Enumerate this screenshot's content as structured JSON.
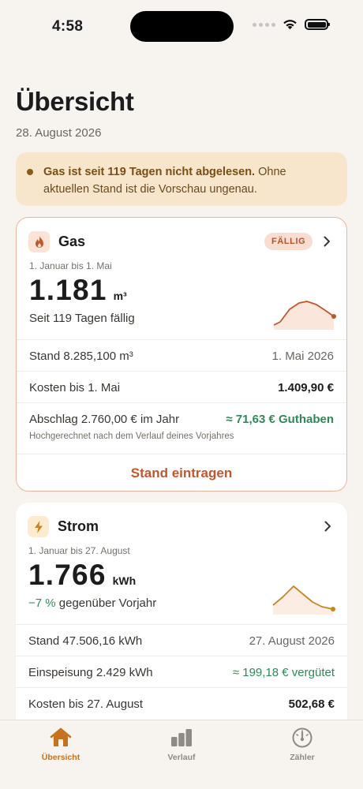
{
  "status": {
    "time": "4:58"
  },
  "header": {
    "title": "Übersicht",
    "date": "28. August 2026"
  },
  "alert": {
    "bold": "Gas ist seit 119 Tagen nicht abgelesen.",
    "text": " Ohne aktuellen Stand ist die Vorschau ungenau."
  },
  "gas": {
    "title": "Gas",
    "badge": "FÄLLIG",
    "period": "1. Januar bis 1. Mai",
    "value": "1.181",
    "unit": "m³",
    "subtitle": "Seit 119 Tagen fällig",
    "reading_label": "Stand 8.285,100 m³",
    "reading_date": "1. Mai 2026",
    "cost_label": "Kosten bis 1. Mai",
    "cost_value": "1.409,90 €",
    "advance_label": "Abschlag 2.760,00 € im Jahr",
    "advance_value": "≈ 71,63 € Guthaben",
    "advance_note": "Hochgerechnet nach dem Verlauf deines Vorjahres",
    "action_label": "Stand eintragen",
    "color": "#c0572d"
  },
  "strom": {
    "title": "Strom",
    "period": "1. Januar bis 27. August",
    "value": "1.766",
    "unit": "kWh",
    "change": "−7 %",
    "change_text": "gegenüber Vorjahr",
    "reading_label": "Stand 47.506,16 kWh",
    "reading_date": "27. August 2026",
    "feed_label": "Einspeisung 2.429 kWh",
    "feed_value": "≈ 199,18 € vergütet",
    "cost_label": "Kosten bis 27. August",
    "cost_value": "502,68 €",
    "color": "#c7851e"
  },
  "tabs": [
    {
      "label": "Übersicht",
      "icon": "house-icon",
      "active": true
    },
    {
      "label": "Verlauf",
      "icon": "bar-chart-icon",
      "active": false
    },
    {
      "label": "Zähler",
      "icon": "gauge-icon",
      "active": false
    }
  ],
  "colors": {
    "accent": "#c7711e",
    "green": "#2f8a57",
    "gas": "#c0572d",
    "alert_bg": "#f8e6cc"
  }
}
